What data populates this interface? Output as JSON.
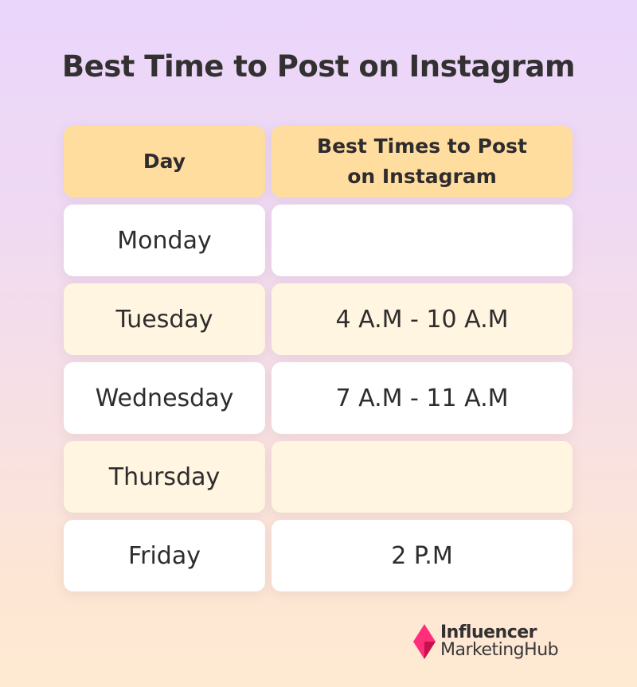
{
  "title": "Best Time to Post on Instagram",
  "table": {
    "headers": {
      "day": "Day",
      "time": "Best Times to Post on Instagram"
    },
    "rows": [
      {
        "day": "Monday",
        "time": ""
      },
      {
        "day": "Tuesday",
        "time": "4 A.M - 10 A.M"
      },
      {
        "day": "Wednesday",
        "time": "7 A.M - 11 A.M"
      },
      {
        "day": "Thursday",
        "time": ""
      },
      {
        "day": "Friday",
        "time": "2 P.M"
      }
    ]
  },
  "logo": {
    "line1": "Influencer",
    "line2": "MarketingHub",
    "icon": "diamond-logo-icon",
    "accent_color": "#e91e63"
  },
  "colors": {
    "header_bg": "#ffdd9f",
    "row_white": "#ffffff",
    "row_cream": "#fff5e0",
    "text": "#2f2c2e"
  }
}
